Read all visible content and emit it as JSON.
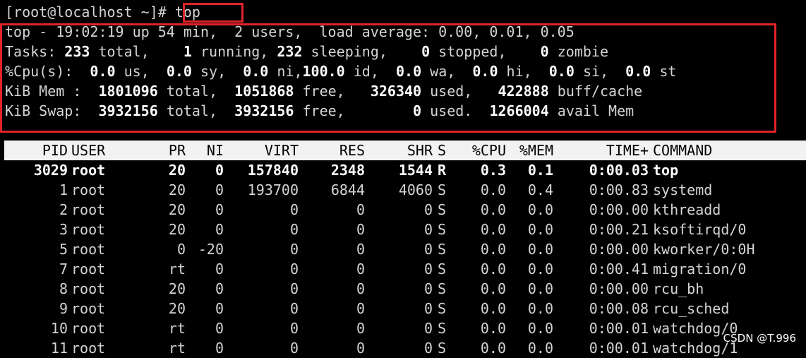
{
  "prompt": {
    "text": "[root@localhost ~]#",
    "command": "top"
  },
  "summary": {
    "line1": "top - 19:02:19 up 54 min,  2 users,  load average: 0.00, 0.01, 0.05",
    "tasks": {
      "label": "Tasks:",
      "total": "233",
      "total_l": "total,",
      "running": "1",
      "running_l": "running,",
      "sleeping": "232",
      "sleeping_l": "sleeping,",
      "stopped": "0",
      "stopped_l": "stopped,",
      "zombie": "0",
      "zombie_l": "zombie"
    },
    "cpu": {
      "label": "%Cpu(s):",
      "us": "0.0",
      "us_l": "us,",
      "sy": "0.0",
      "sy_l": "sy,",
      "ni": "0.0",
      "ni_l": "ni,",
      "id": "100.0",
      "id_l": "id,",
      "wa": "0.0",
      "wa_l": "wa,",
      "hi": "0.0",
      "hi_l": "hi,",
      "si": "0.0",
      "si_l": "si,",
      "st": "0.0",
      "st_l": "st"
    },
    "mem": {
      "label": "KiB Mem :",
      "total": "1801096",
      "total_l": "total,",
      "free": "1051868",
      "free_l": "free,",
      "used": "326340",
      "used_l": "used,",
      "buff": "422888",
      "buff_l": "buff/cache"
    },
    "swap": {
      "label": "KiB Swap:",
      "total": "3932156",
      "total_l": "total,",
      "free": "3932156",
      "free_l": "free,",
      "used": "0",
      "used_l": "used.",
      "avail": "1266004",
      "avail_l": "avail Mem"
    }
  },
  "columns": [
    "PID",
    "USER",
    "PR",
    "NI",
    "VIRT",
    "RES",
    "SHR",
    "S",
    "%CPU",
    "%MEM",
    "TIME+",
    "COMMAND"
  ],
  "processes": [
    {
      "pid": "3029",
      "user": "root",
      "pr": "20",
      "ni": "0",
      "virt": "157840",
      "res": "2348",
      "shr": "1544",
      "s": "R",
      "cpu": "0.3",
      "mem": "0.1",
      "time": "0:00.03",
      "cmd": "top",
      "bold": true
    },
    {
      "pid": "1",
      "user": "root",
      "pr": "20",
      "ni": "0",
      "virt": "193700",
      "res": "6844",
      "shr": "4060",
      "s": "S",
      "cpu": "0.0",
      "mem": "0.4",
      "time": "0:00.83",
      "cmd": "systemd"
    },
    {
      "pid": "2",
      "user": "root",
      "pr": "20",
      "ni": "0",
      "virt": "0",
      "res": "0",
      "shr": "0",
      "s": "S",
      "cpu": "0.0",
      "mem": "0.0",
      "time": "0:00.00",
      "cmd": "kthreadd"
    },
    {
      "pid": "3",
      "user": "root",
      "pr": "20",
      "ni": "0",
      "virt": "0",
      "res": "0",
      "shr": "0",
      "s": "S",
      "cpu": "0.0",
      "mem": "0.0",
      "time": "0:00.21",
      "cmd": "ksoftirqd/0"
    },
    {
      "pid": "5",
      "user": "root",
      "pr": "0",
      "ni": "-20",
      "virt": "0",
      "res": "0",
      "shr": "0",
      "s": "S",
      "cpu": "0.0",
      "mem": "0.0",
      "time": "0:00.00",
      "cmd": "kworker/0:0H"
    },
    {
      "pid": "7",
      "user": "root",
      "pr": "rt",
      "ni": "0",
      "virt": "0",
      "res": "0",
      "shr": "0",
      "s": "S",
      "cpu": "0.0",
      "mem": "0.0",
      "time": "0:00.41",
      "cmd": "migration/0"
    },
    {
      "pid": "8",
      "user": "root",
      "pr": "20",
      "ni": "0",
      "virt": "0",
      "res": "0",
      "shr": "0",
      "s": "S",
      "cpu": "0.0",
      "mem": "0.0",
      "time": "0:00.00",
      "cmd": "rcu_bh"
    },
    {
      "pid": "9",
      "user": "root",
      "pr": "20",
      "ni": "0",
      "virt": "0",
      "res": "0",
      "shr": "0",
      "s": "S",
      "cpu": "0.0",
      "mem": "0.0",
      "time": "0:00.08",
      "cmd": "rcu_sched"
    },
    {
      "pid": "10",
      "user": "root",
      "pr": "rt",
      "ni": "0",
      "virt": "0",
      "res": "0",
      "shr": "0",
      "s": "S",
      "cpu": "0.0",
      "mem": "0.0",
      "time": "0:00.01",
      "cmd": "watchdog/0"
    },
    {
      "pid": "11",
      "user": "root",
      "pr": "rt",
      "ni": "0",
      "virt": "0",
      "res": "0",
      "shr": "0",
      "s": "S",
      "cpu": "0.0",
      "mem": "0.0",
      "time": "0:00.01",
      "cmd": "watchdog/1"
    }
  ],
  "watermark": "CSDN @T.996",
  "colors": {
    "highlight_box": "#e0242a",
    "background": "#000000",
    "header_bg": "#f2f2f2"
  }
}
